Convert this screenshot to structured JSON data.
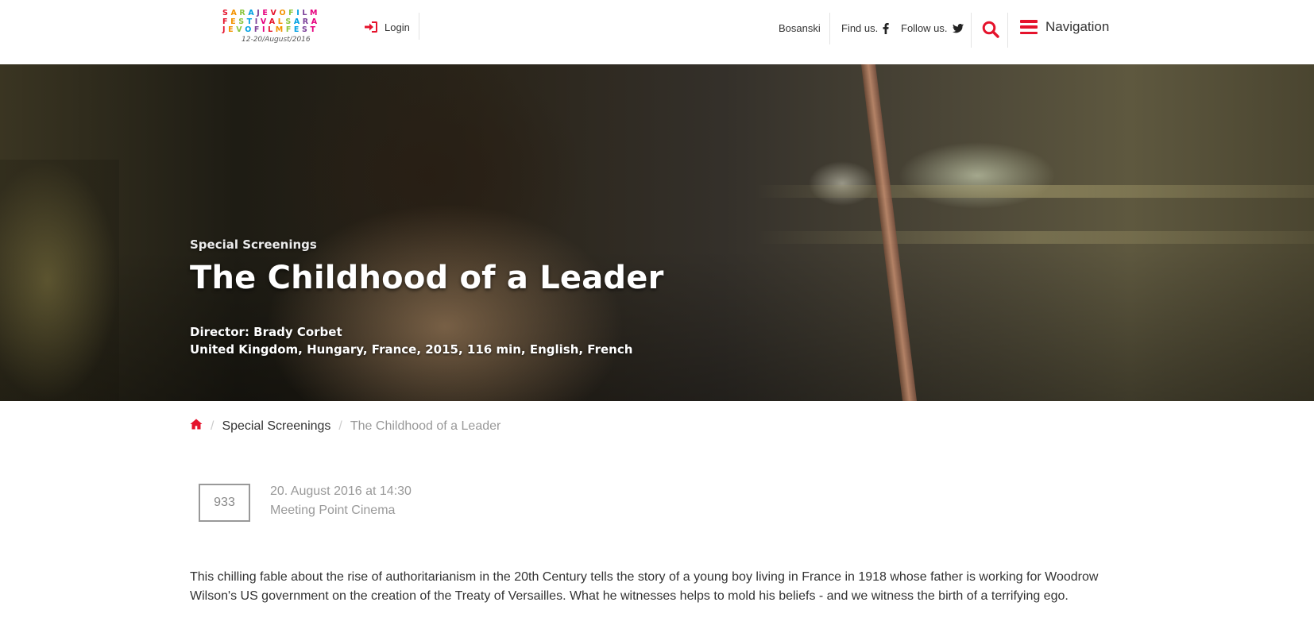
{
  "header": {
    "logo": {
      "lines": [
        "SARAJEVOFILM",
        "FESTIVALSARA",
        "JEVOFILMFEST"
      ],
      "date": "12-20/August/2016",
      "colors": [
        "#e5132c",
        "#f39200",
        "#8cc63f",
        "#00a0e3",
        "#7b3f98",
        "#e6007e"
      ]
    },
    "login_label": "Login",
    "language_label": "Bosanski",
    "find_us_label": "Find us.",
    "follow_us_label": "Follow us.",
    "navigation_label": "Navigation",
    "icons": {
      "login": "sign-in-icon",
      "facebook": "facebook-icon",
      "twitter": "twitter-icon",
      "search": "search-icon",
      "menu": "hamburger-menu-icon"
    },
    "accent_color": "#e5132c"
  },
  "hero": {
    "category": "Special Screenings",
    "title": "The Childhood of a Leader",
    "director": "Director: Brady Corbet",
    "details": "United Kingdom, Hungary, France, 2015, 116 min, English, French"
  },
  "breadcrumb": {
    "home_icon": "home-icon",
    "items": [
      "Special Screenings",
      "The Childhood of a Leader"
    ]
  },
  "screening": {
    "code": "933",
    "date": "20. August 2016 at 14:30",
    "venue": "Meeting Point Cinema"
  },
  "synopsis": "This chilling fable about the rise of authoritarianism in the 20th Century tells the story of a young boy living in France in 1918 whose father is working for Woodrow Wilson's US government on the creation of the Treaty of Versailles. What he witnesses helps to mold his beliefs - and we witness the birth of a terrifying ego."
}
